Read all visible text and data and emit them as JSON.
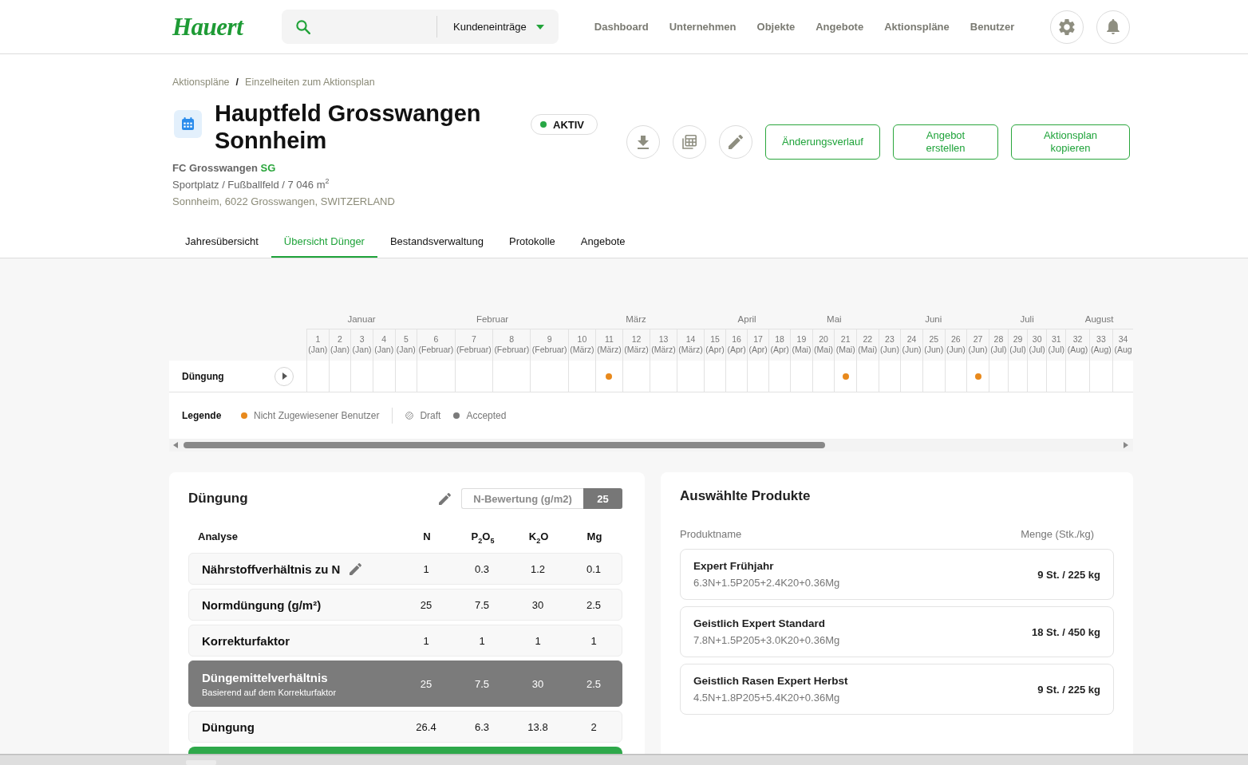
{
  "header": {
    "logo": "Hauert",
    "search": {
      "scope": "Kundeneinträge"
    },
    "nav": [
      {
        "label": "Dashboard",
        "selected": false
      },
      {
        "label": "Unternehmen",
        "selected": false
      },
      {
        "label": "Objekte",
        "selected": false
      },
      {
        "label": "Angebote",
        "selected": false
      },
      {
        "label": "Aktionspläne",
        "selected": false
      },
      {
        "label": "Benutzer",
        "selected": false
      }
    ]
  },
  "breadcrumb": {
    "items": [
      {
        "label": "Aktionspläne"
      },
      {
        "label": "Einzelheiten zum Aktionsplan"
      }
    ],
    "separator": "/"
  },
  "plan": {
    "title": "Hauptfeld Grosswangen Sonnheim",
    "status": {
      "label": "AKTIV",
      "active": true
    },
    "club": "FC Grosswangen",
    "club_code": "SG",
    "details": "Sportplatz / Fußballfeld / 7 046 m$^{2}$",
    "address": "Sonnheim, 6022 Grosswangen, SWITZERLAND",
    "actions": [
      {
        "label": "Änderungsverlauf"
      },
      {
        "label": "Angebot erstellen"
      },
      {
        "label": "Aktionsplan kopieren"
      }
    ]
  },
  "tabs": [
    {
      "label": "Jahresübersicht",
      "selected": false
    },
    {
      "label": "Übersicht Dünger",
      "selected": true
    },
    {
      "label": "Bestandsverwaltung",
      "selected": false
    },
    {
      "label": "Protokolle",
      "selected": false
    },
    {
      "label": "Angebote",
      "selected": false
    }
  ],
  "timeline": {
    "months": [
      {
        "name": "Januar",
        "weeks": [
          {
            "number": "1",
            "month": "(Jan)"
          },
          {
            "number": "2",
            "month": "(Jan)"
          },
          {
            "number": "3",
            "month": "(Jan)"
          },
          {
            "number": "4",
            "month": "(Jan)"
          },
          {
            "number": "5",
            "month": "(Jan)"
          }
        ]
      },
      {
        "name": "Februar",
        "weeks": [
          {
            "number": "6",
            "month": "(Februar)"
          },
          {
            "number": "7",
            "month": "(Februar)"
          },
          {
            "number": "8",
            "month": "(Februar)"
          },
          {
            "number": "9",
            "month": "(Februar)"
          }
        ]
      },
      {
        "name": "März",
        "weeks": [
          {
            "number": "10",
            "month": "(März)"
          },
          {
            "number": "11",
            "month": "(März)"
          },
          {
            "number": "12",
            "month": "(März)"
          },
          {
            "number": "13",
            "month": "(März)"
          },
          {
            "number": "14",
            "month": "(März)"
          }
        ]
      },
      {
        "name": "April",
        "weeks": [
          {
            "number": "15",
            "month": "(Apr)"
          },
          {
            "number": "16",
            "month": "(Apr)"
          },
          {
            "number": "17",
            "month": "(Apr)"
          },
          {
            "number": "18",
            "month": "(Apr)"
          }
        ]
      },
      {
        "name": "Mai",
        "weeks": [
          {
            "number": "19",
            "month": "(Mai)"
          },
          {
            "number": "20",
            "month": "(Mai)"
          },
          {
            "number": "21",
            "month": "(Mai)"
          },
          {
            "number": "22",
            "month": "(Mai)"
          }
        ]
      },
      {
        "name": "Juni",
        "weeks": [
          {
            "number": "23",
            "month": "(Jun)"
          },
          {
            "number": "24",
            "month": "(Jun)"
          },
          {
            "number": "25",
            "month": "(Jun)"
          },
          {
            "number": "26",
            "month": "(Jun)"
          },
          {
            "number": "27",
            "month": "(Jun)"
          }
        ]
      },
      {
        "name": "Juli",
        "weeks": [
          {
            "number": "28",
            "month": "(Jul)"
          },
          {
            "number": "29",
            "month": "(Jul)"
          },
          {
            "number": "30",
            "month": "(Jul)"
          },
          {
            "number": "31",
            "month": "(Jul)"
          }
        ]
      },
      {
        "name": "August",
        "weeks": [
          {
            "number": "32",
            "month": "(Aug)"
          },
          {
            "number": "33",
            "month": "(Aug)"
          },
          {
            "number": "34",
            "month": "(Aug"
          }
        ]
      }
    ],
    "rows": [
      {
        "label": "Düngung",
        "expanded": false,
        "cells": [
          {
            "kind": "empty"
          },
          {
            "kind": "empty"
          },
          {
            "kind": "empty"
          },
          {
            "kind": "empty"
          },
          {
            "kind": "empty"
          },
          {
            "kind": "empty"
          },
          {
            "kind": "empty"
          },
          {
            "kind": "empty"
          },
          {
            "kind": "empty"
          },
          {
            "kind": "empty"
          },
          {
            "kind": "unassigned"
          },
          {
            "kind": "empty"
          },
          {
            "kind": "empty"
          },
          {
            "kind": "empty"
          },
          {
            "kind": "empty"
          },
          {
            "kind": "empty"
          },
          {
            "kind": "empty"
          },
          {
            "kind": "empty"
          },
          {
            "kind": "empty"
          },
          {
            "kind": "empty"
          },
          {
            "kind": "unassigned"
          },
          {
            "kind": "empty"
          },
          {
            "kind": "empty"
          },
          {
            "kind": "empty"
          },
          {
            "kind": "empty"
          },
          {
            "kind": "empty"
          },
          {
            "kind": "unassigned"
          },
          {
            "kind": "empty"
          },
          {
            "kind": "empty"
          },
          {
            "kind": "empty"
          },
          {
            "kind": "empty"
          },
          {
            "kind": "empty"
          },
          {
            "kind": "empty"
          },
          {
            "kind": "empty"
          }
        ]
      }
    ],
    "legend": {
      "title": "Legende",
      "items": [
        {
          "kind": "unassigned",
          "label": "Nicht Zugewiesener Benutzer",
          "color": "#e8891c"
        },
        {
          "kind": "draft",
          "label": "Draft"
        },
        {
          "kind": "accepted",
          "label": "Accepted",
          "color": "#7a7a7a"
        }
      ]
    }
  },
  "fertilization": {
    "title": "Düngung",
    "n_rating": {
      "label": "N-Bewertung (g/m2)",
      "value": "25"
    },
    "columns": [
      "Analyse",
      "N",
      "P$_{2}$O$_{5}$",
      "K$_{2}$O",
      "Mg"
    ],
    "rows": [
      {
        "kind": "plain",
        "label": "Nährstoffverhältnis zu N",
        "editable": true,
        "values": [
          "1",
          "0.3",
          "1.2",
          "0.1"
        ]
      },
      {
        "kind": "plain",
        "label": "Normdüngung (g/m²)",
        "editable": false,
        "values": [
          "25",
          "7.5",
          "30",
          "2.5"
        ]
      },
      {
        "kind": "plain",
        "label": "Korrekturfaktor",
        "editable": false,
        "values": [
          "1",
          "1",
          "1",
          "1"
        ]
      },
      {
        "kind": "highlight",
        "label": "Düngemittelverhältnis",
        "note": "Basierend auf dem Korrekturfaktor",
        "editable": false,
        "values": [
          "25",
          "7.5",
          "30",
          "2.5"
        ]
      },
      {
        "kind": "plain",
        "label": "Düngung",
        "editable": false,
        "values": [
          "26.4",
          "6.3",
          "13.8",
          "2"
        ]
      },
      {
        "kind": "total"
      }
    ]
  },
  "products": {
    "title": "Auswählte Produkte",
    "columns": [
      "Produktname",
      "Menge (Stk./kg)"
    ],
    "items": [
      {
        "name": "Expert Frühjahr",
        "formula": "6.3N+1.5P205+2.4K20+0.36Mg",
        "quantity": "9 St. / 225 kg"
      },
      {
        "name": "Geistlich Expert Standard",
        "formula": "7.8N+1.5P205+3.0K20+0.36Mg",
        "quantity": "18 St. / 450 kg"
      },
      {
        "name": "Geistlich Rasen Expert Herbst",
        "formula": "4.5N+1.8P205+5.4K20+0.36Mg",
        "quantity": "9 St. / 225 kg"
      }
    ]
  }
}
